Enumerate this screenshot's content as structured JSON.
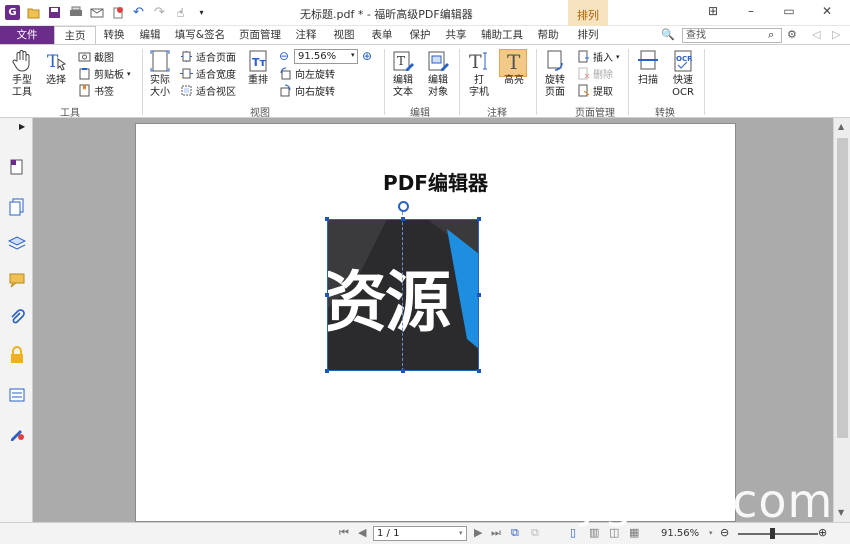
{
  "window": {
    "title": "无标题.pdf * - 福昕高级PDF编辑器",
    "context_tab_head": "排列"
  },
  "tabs": [
    {
      "label": "文件"
    },
    {
      "label": "主页"
    },
    {
      "label": "转换"
    },
    {
      "label": "编辑"
    },
    {
      "label": "填写&签名"
    },
    {
      "label": "页面管理"
    },
    {
      "label": "注释"
    },
    {
      "label": "视图"
    },
    {
      "label": "表单"
    },
    {
      "label": "保护"
    },
    {
      "label": "共享"
    },
    {
      "label": "辅助工具"
    },
    {
      "label": "帮助"
    },
    {
      "label": "排列"
    }
  ],
  "search": {
    "placeholder": "查找"
  },
  "ribbon": {
    "tools": {
      "hand": "手型\n工具",
      "select": "选择",
      "screenshot": "截图",
      "clipboard": "剪贴板",
      "bookmark": "书签",
      "group": "工具"
    },
    "view": {
      "actual_size": "实际\n大小",
      "fit_page": "适合页面",
      "fit_width": "适合宽度",
      "fit_visible": "适合视区",
      "reflow": "重排",
      "zoom": "91.56%",
      "rotate_left": "向左旋转",
      "rotate_right": "向右旋转",
      "group": "视图"
    },
    "edit": {
      "edit_text": "编辑\n文本",
      "edit_object": "编辑\n对象",
      "group": "编辑"
    },
    "comment": {
      "typewriter": "打\n字机",
      "highlight": "高亮",
      "group": "注释"
    },
    "pages": {
      "rotate_page": "旋转\n页面",
      "insert": "插入",
      "delete": "删除",
      "extract": "提取",
      "group": "页面管理"
    },
    "convert": {
      "scan": "扫描",
      "quick_ocr": "快速\nOCR",
      "group": "转换"
    }
  },
  "document": {
    "heading": "PDF编辑器",
    "image_text": "资源"
  },
  "status": {
    "page": "1 / 1",
    "zoom": "91.56%"
  },
  "watermark": "www.ygbks.com",
  "colors": {
    "brand": "#6b2c8a",
    "selection": "#2a62c3",
    "highlight": "#f3c988"
  }
}
